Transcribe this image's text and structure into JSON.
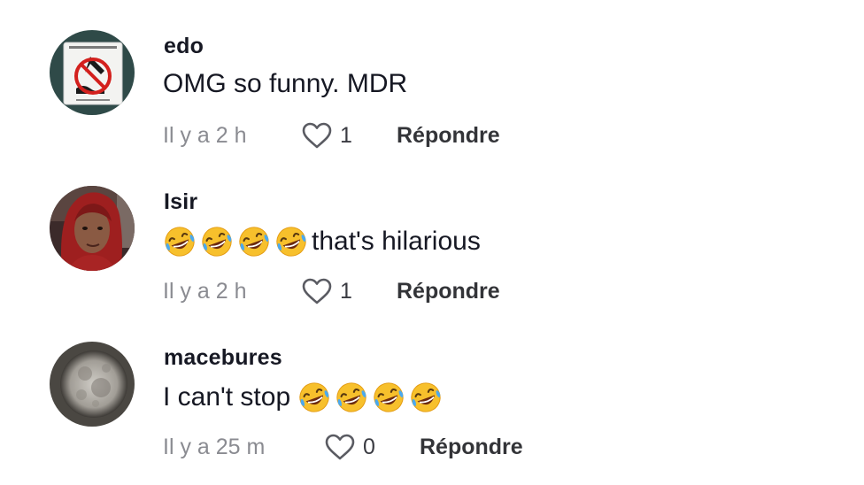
{
  "comments": [
    {
      "username": "edo",
      "text": "OMG so funny. MDR",
      "emoji_before": 0,
      "emoji_after": 0,
      "time": "Il y a 2 h",
      "likes": "1",
      "reply_label": "Répondre",
      "avatar_icon": "no-diving-sign"
    },
    {
      "username": "Isir",
      "text": "that's hilarious",
      "emoji_before": 4,
      "emoji_after": 0,
      "emoji_name": "rolling-on-floor-laughing",
      "time": "Il y a 2 h",
      "likes": "1",
      "reply_label": "Répondre",
      "avatar_icon": "person-photo"
    },
    {
      "username": "macebures",
      "text": "I can't stop",
      "emoji_before": 0,
      "emoji_after": 4,
      "emoji_name": "rolling-on-floor-laughing",
      "time": "Il y a 25 m",
      "likes": "0",
      "reply_label": "Répondre",
      "avatar_icon": "moon-photo"
    }
  ]
}
